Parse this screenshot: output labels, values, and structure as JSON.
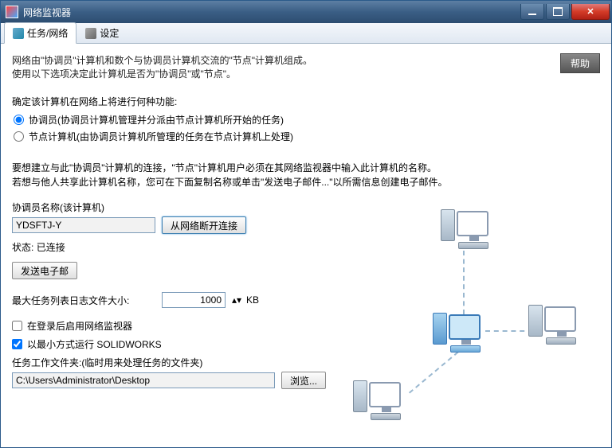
{
  "window": {
    "title": "网络监视器"
  },
  "tabs": {
    "tasks": "任务/网络",
    "settings": "设定"
  },
  "intro": {
    "line1": "网络由\"协调员\"计算机和数个与协调员计算机交流的\"节点\"计算机组成。",
    "line2": "使用以下选项决定此计算机是否为\"协调员\"或\"节点\"。"
  },
  "help": "帮助",
  "roleprompt": "确定该计算机在网络上将进行何种功能:",
  "radio": {
    "coord": "协调员(协调员计算机管理并分派由节点计算机所开始的任务)",
    "node": "节点计算机(由协调员计算机所管理的任务在节点计算机上处理)"
  },
  "para2a": "要想建立与此\"协调员\"计算机的连接，\"节点\"计算机用户必须在其网络监视器中输入此计算机的名称。",
  "para2b": "若想与他人共享此计算机名称，您可在下面复制名称或单击\"发送电子邮件...\"以所需信息创建电子邮件。",
  "coordname": {
    "label": "协调员名称(该计算机)",
    "value": "YDSFTJ-Y"
  },
  "disconnect": "从网络断开连接",
  "status": {
    "label": "状态:",
    "value": "已连接"
  },
  "sendemail": "发送电子邮",
  "logsize": {
    "label": "最大任务列表日志文件大小:",
    "value": "1000",
    "unit": "KB"
  },
  "chk": {
    "startlogin": "在登录后启用网络监视器",
    "minsw": "以最小方式运行 SOLIDWORKS"
  },
  "workfolder": {
    "label": "任务工作文件夹:(临时用来处理任务的文件夹)",
    "value": "C:\\Users\\Administrator\\Desktop"
  },
  "browse": "浏览..."
}
